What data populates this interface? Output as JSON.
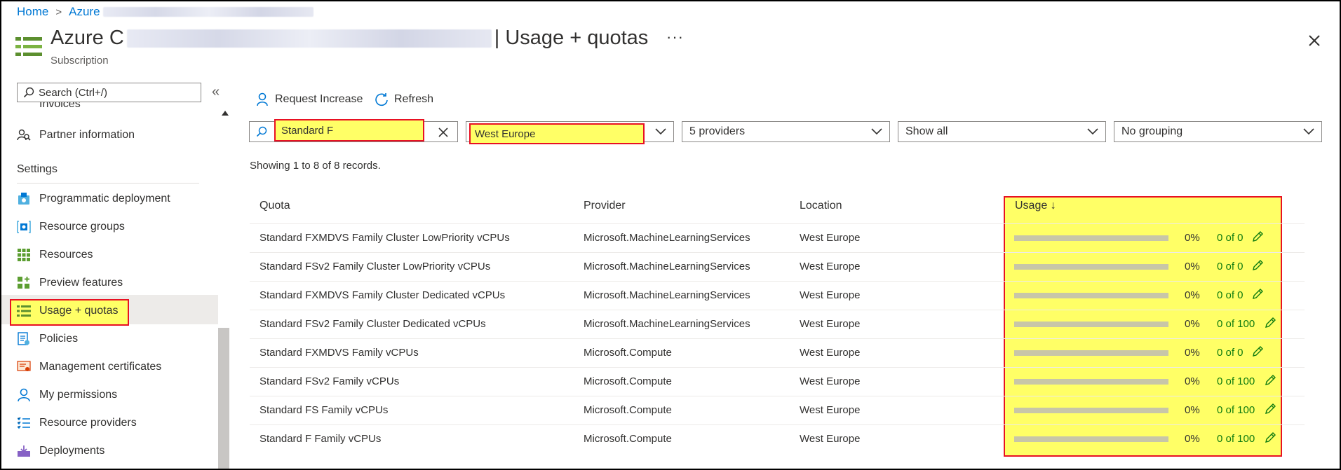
{
  "breadcrumb": {
    "home": "Home",
    "current": "Azure"
  },
  "header": {
    "title_prefix": "Azure C",
    "title_suffix": "| Usage + quotas",
    "subtitle": "Subscription",
    "more": "···"
  },
  "sidebar": {
    "search_placeholder": "Search (Ctrl+/)",
    "collapse": "«",
    "cut_item": "Invoices",
    "partner": "Partner information",
    "settings_heading": "Settings",
    "items": [
      {
        "label": "Programmatic deployment",
        "icon": "deploy-icon"
      },
      {
        "label": "Resource groups",
        "icon": "resource-group-icon"
      },
      {
        "label": "Resources",
        "icon": "grid-icon"
      },
      {
        "label": "Preview features",
        "icon": "preview-icon"
      },
      {
        "label": "Usage + quotas",
        "icon": "quota-icon"
      },
      {
        "label": "Policies",
        "icon": "policy-icon"
      },
      {
        "label": "Management certificates",
        "icon": "certificate-icon"
      },
      {
        "label": "My permissions",
        "icon": "person-icon"
      },
      {
        "label": "Resource providers",
        "icon": "list-icon"
      },
      {
        "label": "Deployments",
        "icon": "deployments-icon"
      }
    ]
  },
  "toolbar": {
    "request_increase": "Request Increase",
    "refresh": "Refresh"
  },
  "filters": {
    "search_value": "Standard F",
    "location": "West Europe",
    "providers": "5 providers",
    "usage_filter": "Show all",
    "grouping": "No grouping"
  },
  "records_text": "Showing 1 to 8 of 8 records.",
  "table": {
    "columns": {
      "quota": "Quota",
      "provider": "Provider",
      "location": "Location",
      "usage": "Usage ↓"
    },
    "rows": [
      {
        "quota": "Standard FXMDVS Family Cluster LowPriority vCPUs",
        "provider": "Microsoft.MachineLearningServices",
        "location": "West Europe",
        "percent": "0%",
        "count": "0 of 0",
        "fraction": 0
      },
      {
        "quota": "Standard FSv2 Family Cluster LowPriority vCPUs",
        "provider": "Microsoft.MachineLearningServices",
        "location": "West Europe",
        "percent": "0%",
        "count": "0 of 0",
        "fraction": 0
      },
      {
        "quota": "Standard FXMDVS Family Cluster Dedicated vCPUs",
        "provider": "Microsoft.MachineLearningServices",
        "location": "West Europe",
        "percent": "0%",
        "count": "0 of 0",
        "fraction": 0
      },
      {
        "quota": "Standard FSv2 Family Cluster Dedicated vCPUs",
        "provider": "Microsoft.MachineLearningServices",
        "location": "West Europe",
        "percent": "0%",
        "count": "0 of 100",
        "fraction": 0
      },
      {
        "quota": "Standard FXMDVS Family vCPUs",
        "provider": "Microsoft.Compute",
        "location": "West Europe",
        "percent": "0%",
        "count": "0 of 0",
        "fraction": 0
      },
      {
        "quota": "Standard FSv2 Family vCPUs",
        "provider": "Microsoft.Compute",
        "location": "West Europe",
        "percent": "0%",
        "count": "0 of 100",
        "fraction": 0
      },
      {
        "quota": "Standard FS Family vCPUs",
        "provider": "Microsoft.Compute",
        "location": "West Europe",
        "percent": "0%",
        "count": "0 of 100",
        "fraction": 0
      },
      {
        "quota": "Standard F Family vCPUs",
        "provider": "Microsoft.Compute",
        "location": "West Europe",
        "percent": "0%",
        "count": "0 of 100",
        "fraction": 0
      }
    ]
  },
  "colors": {
    "accent": "#0078d4",
    "highlight": "#ffff66",
    "highlight_border": "#e81123",
    "count_green": "#107c10"
  }
}
